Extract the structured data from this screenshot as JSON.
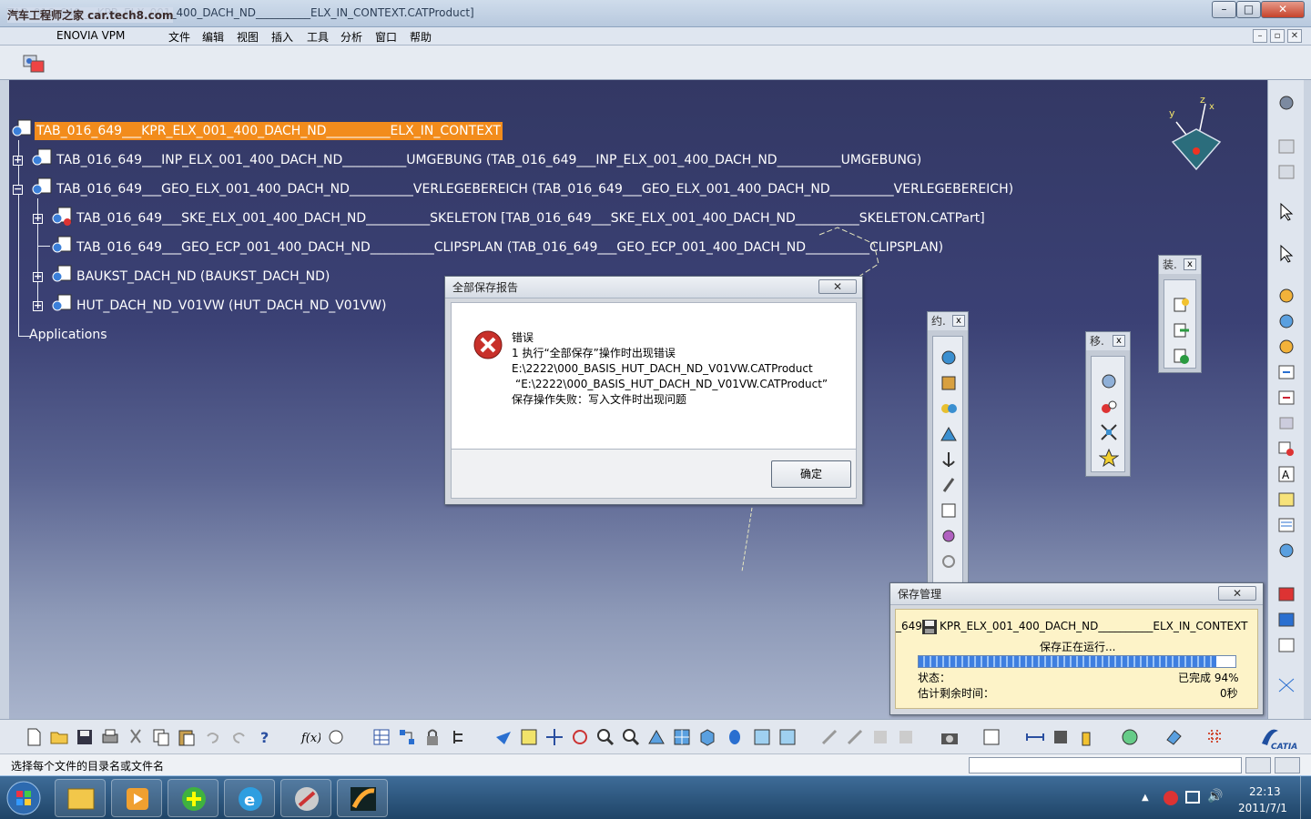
{
  "window": {
    "title": "TAB_016_649___KPR_ELX_001_400_DACH_ND__________ELX_IN_CONTEXT.CATProduct]",
    "watermark": "汽车工程师之家 car.tech8.com",
    "minimize": "–",
    "maximize": "□",
    "close": "✕"
  },
  "menu": {
    "items": [
      "ENOVIA VPM",
      "文件",
      "编辑",
      "视图",
      "插入",
      "工具",
      "分析",
      "窗口",
      "帮助"
    ],
    "mdi_min": "–",
    "mdi_restore": "▫",
    "mdi_close": "✕"
  },
  "tree": {
    "root": "TAB_016_649___KPR_ELX_001_400_DACH_ND__________ELX_IN_CONTEXT",
    "nodes": [
      "TAB_016_649___INP_ELX_001_400_DACH_ND__________UMGEBUNG (TAB_016_649___INP_ELX_001_400_DACH_ND__________UMGEBUNG)",
      "TAB_016_649___GEO_ELX_001_400_DACH_ND__________VERLEGEBEREICH (TAB_016_649___GEO_ELX_001_400_DACH_ND__________VERLEGEBEREICH)",
      "TAB_016_649___SKE_ELX_001_400_DACH_ND__________SKELETON [TAB_016_649___SKE_ELX_001_400_DACH_ND__________SKELETON.CATPart]",
      "TAB_016_649___GEO_ECP_001_400_DACH_ND__________CLIPSPLAN (TAB_016_649___GEO_ECP_001_400_DACH_ND__________CLIPSPLAN)",
      "BAUKST_DACH_ND (BAUKST_DACH_ND)",
      "HUT_DACH_ND_V01VW (HUT_DACH_ND_V01VW)"
    ],
    "applications": "Applications",
    "plus": "+",
    "minus": "−"
  },
  "compass": {
    "z": "z",
    "x": "x",
    "y": "y"
  },
  "error_dialog": {
    "title": "全部保存报告",
    "close": "✕",
    "heading": "错误",
    "line1": "1 执行“全部保存”操作时出现错误",
    "line2": "E:\\2222\\000_BASIS_HUT_DACH_ND_V01VW.CATProduct",
    "line3": "“E:\\2222\\000_BASIS_HUT_DACH_ND_V01VW.CATProduct”",
    "line4": "保存操作失败：写入文件时出现问题",
    "ok": "确定"
  },
  "palettes": {
    "constraints": {
      "title": "约.",
      "close": "x"
    },
    "move": {
      "title": "移.",
      "close": "x"
    },
    "assembly": {
      "title": "装.",
      "close": "x"
    }
  },
  "save_manager": {
    "title": "保存管理",
    "close": "✕",
    "file_prefix": "_649",
    "file": "KPR_ELX_001_400_DACH_ND__________ELX_IN_CONTEXT",
    "running": "保存正在运行...",
    "progress": 0.94,
    "status_label": "状态：",
    "status_value": "已完成 94%",
    "remaining_label": "估计剩余时间：",
    "remaining_value": "0秒"
  },
  "status": {
    "message": "选择每个文件的目录名或文件名"
  },
  "taskbar": {
    "time": "22:13",
    "date": "2011/7/1"
  },
  "colors": {
    "selection": "#f28c1c",
    "viewport_top": "#333864",
    "viewport_bottom": "#a9b4cc",
    "progress": "#3f7fe0"
  }
}
